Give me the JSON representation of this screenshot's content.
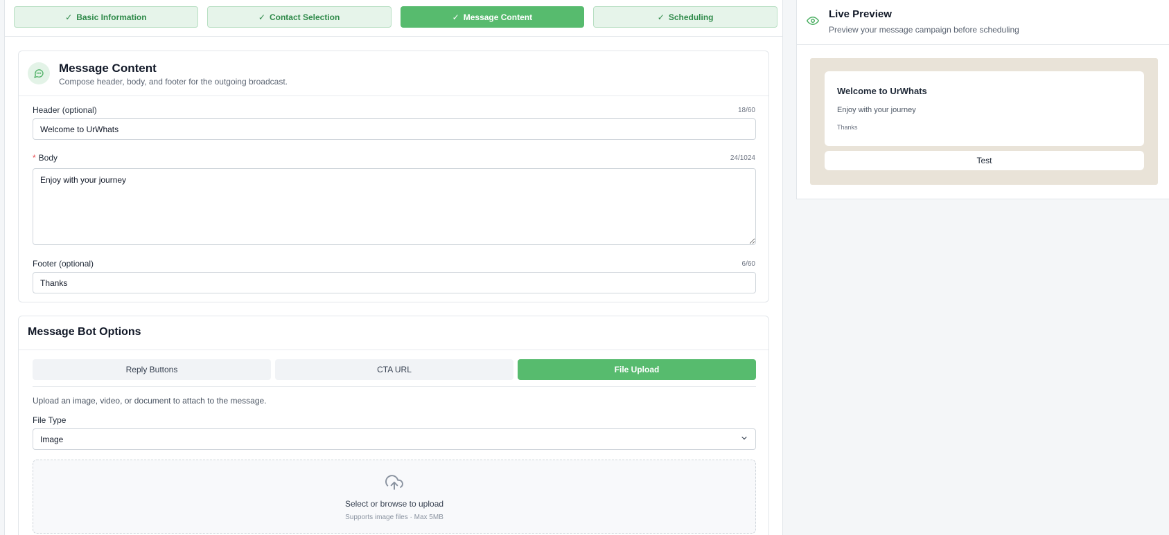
{
  "stepper": {
    "steps": [
      {
        "label": "Basic Information",
        "state": "done"
      },
      {
        "label": "Contact Selection",
        "state": "done"
      },
      {
        "label": "Message Content",
        "state": "active"
      },
      {
        "label": "Scheduling",
        "state": "done"
      }
    ]
  },
  "message_content": {
    "title": "Message Content",
    "subtitle": "Compose header, body, and footer for the outgoing broadcast.",
    "header": {
      "label": "Header (optional)",
      "counter": "18/60",
      "value": "Welcome to UrWhats"
    },
    "body": {
      "required_mark": "*",
      "label": "Body",
      "counter": "24/1024",
      "value": "Enjoy with your journey"
    },
    "footer": {
      "label": "Footer (optional)",
      "counter": "6/60",
      "value": "Thanks"
    }
  },
  "bot_options": {
    "title": "Message Bot Options",
    "tabs": [
      {
        "label": "Reply Buttons",
        "active": false
      },
      {
        "label": "CTA URL",
        "active": false
      },
      {
        "label": "File Upload",
        "active": true
      }
    ],
    "description": "Upload an image, video, or document to attach to the message.",
    "file_type": {
      "label": "File Type",
      "value": "Image"
    },
    "dropzone": {
      "text": "Select or browse to upload",
      "subtext": "Supports image files · Max 5MB"
    }
  },
  "live_preview": {
    "title": "Live Preview",
    "subtitle": "Preview your message campaign before scheduling",
    "message": {
      "header": "Welcome to UrWhats",
      "body": "Enjoy with your journey",
      "footer": "Thanks"
    },
    "button_label": "Test"
  },
  "colors": {
    "accent": "#57bb6e",
    "accent_light": "#e6f4ea",
    "accent_text": "#2f8a4a"
  },
  "icons": {
    "step_check": "check-icon",
    "message": "chat-bubble-icon",
    "upload": "cloud-upload-icon",
    "preview": "eye-icon",
    "select": "chevron-down-icon"
  }
}
